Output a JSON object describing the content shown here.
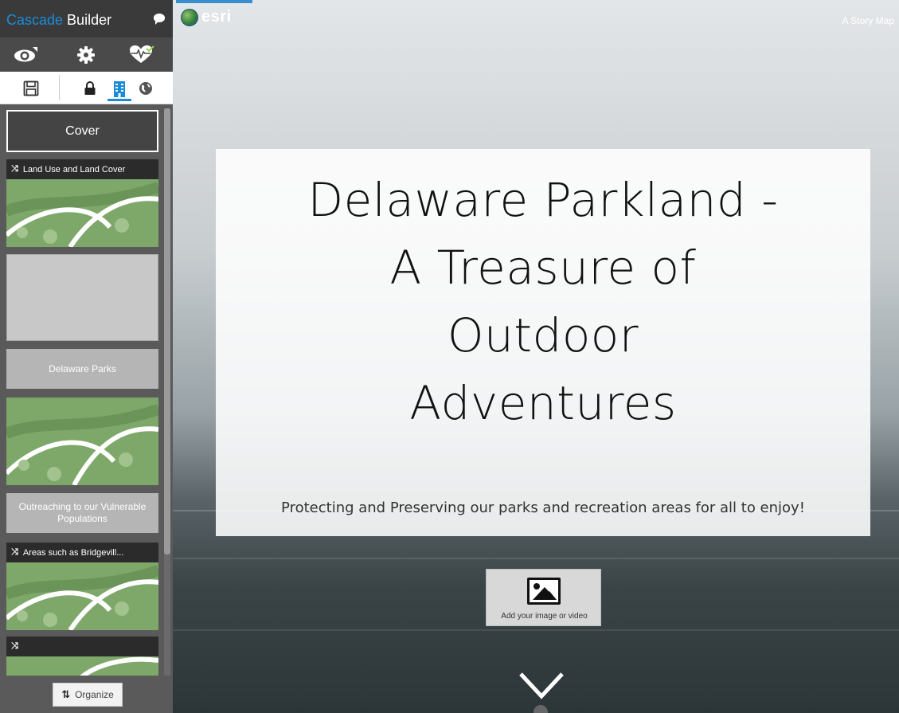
{
  "builder": {
    "title_accent": "Cascade",
    "title_rest": " Builder",
    "icons": [
      "chat-icon",
      "eye-icon",
      "gear-icon",
      "health-check-icon",
      "save-icon",
      "lock-icon",
      "building-icon",
      "globe-icon"
    ]
  },
  "sidebar": {
    "sections": [
      {
        "kind": "cover",
        "label": "Cover"
      },
      {
        "kind": "sequence",
        "label": "Land Use and Land Cover"
      },
      {
        "kind": "blank"
      },
      {
        "kind": "text",
        "label": "Delaware Parks"
      },
      {
        "kind": "map"
      },
      {
        "kind": "text",
        "label": "Outreaching to our Vulnerable Populations"
      },
      {
        "kind": "sequence",
        "label": "Areas such as Bridgevill..."
      },
      {
        "kind": "sequence",
        "label": ""
      }
    ],
    "organize_label": "Organize"
  },
  "main": {
    "logo_text": "esri",
    "story_map_label": "A Story Map",
    "title_lines": [
      "Delaware Parkland -",
      "A Treasure of",
      "Outdoor",
      "Adventures"
    ],
    "subtitle": "Protecting and Preserving our parks and recreation areas for all to enjoy!",
    "media_label": "Add your image or video"
  },
  "colors": {
    "accent": "#1a8cd8",
    "sidebar_bg": "#5a5a5a",
    "header_bg": "#3a3a3a",
    "map_green": "#7ea86a"
  }
}
